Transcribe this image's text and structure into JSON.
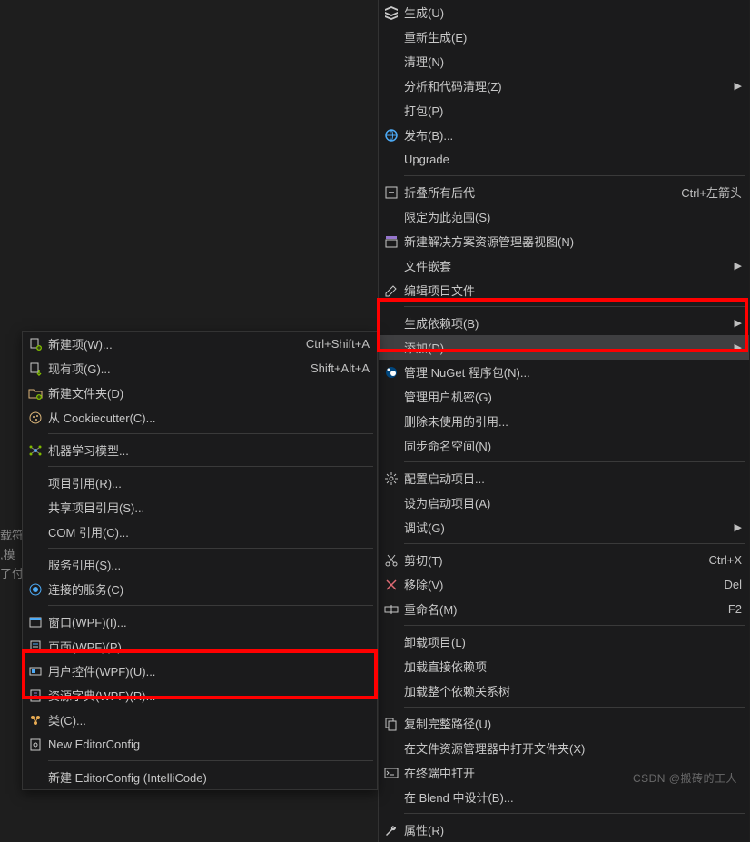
{
  "bg": {
    "line1": "载符",
    "line2": ",模",
    "line3": "了付"
  },
  "main_menu": {
    "items": [
      {
        "icon": "build",
        "label": "生成(U)"
      },
      {
        "icon": "",
        "label": "重新生成(E)"
      },
      {
        "icon": "",
        "label": "清理(N)"
      },
      {
        "icon": "",
        "label": "分析和代码清理(Z)",
        "arrow": true
      },
      {
        "icon": "",
        "label": "打包(P)"
      },
      {
        "icon": "publish",
        "label": "发布(B)..."
      },
      {
        "icon": "",
        "label": "Upgrade"
      },
      {
        "sep": true
      },
      {
        "icon": "collapse",
        "label": "折叠所有后代",
        "shortcut": "Ctrl+左箭头"
      },
      {
        "icon": "",
        "label": "限定为此范围(S)"
      },
      {
        "icon": "view",
        "label": "新建解决方案资源管理器视图(N)"
      },
      {
        "icon": "",
        "label": "文件嵌套",
        "arrow": true
      },
      {
        "icon": "edit",
        "label": "编辑项目文件"
      },
      {
        "sep": true
      },
      {
        "icon": "",
        "label": "生成依赖项(B)",
        "arrow": true
      },
      {
        "icon": "",
        "label": "添加(D)",
        "arrow": true,
        "highlight": true
      },
      {
        "icon": "nuget",
        "label": "管理 NuGet 程序包(N)..."
      },
      {
        "icon": "",
        "label": "管理用户机密(G)"
      },
      {
        "icon": "",
        "label": "删除未使用的引用..."
      },
      {
        "icon": "",
        "label": "同步命名空间(N)"
      },
      {
        "sep": true
      },
      {
        "icon": "gear",
        "label": "配置启动项目..."
      },
      {
        "icon": "",
        "label": "设为启动项目(A)"
      },
      {
        "icon": "",
        "label": "调试(G)",
        "arrow": true
      },
      {
        "sep": true
      },
      {
        "icon": "cut",
        "label": "剪切(T)",
        "shortcut": "Ctrl+X"
      },
      {
        "icon": "remove",
        "label": "移除(V)",
        "shortcut": "Del"
      },
      {
        "icon": "rename",
        "label": "重命名(M)",
        "shortcut": "F2"
      },
      {
        "sep": true
      },
      {
        "icon": "",
        "label": "卸载项目(L)"
      },
      {
        "icon": "",
        "label": "加载直接依赖项"
      },
      {
        "icon": "",
        "label": "加载整个依赖关系树"
      },
      {
        "sep": true
      },
      {
        "icon": "copy",
        "label": "复制完整路径(U)"
      },
      {
        "icon": "",
        "label": "在文件资源管理器中打开文件夹(X)"
      },
      {
        "icon": "terminal",
        "label": "在终端中打开"
      },
      {
        "icon": "",
        "label": "在 Blend 中设计(B)..."
      },
      {
        "sep": true
      },
      {
        "icon": "wrench",
        "label": "属性(R)"
      }
    ]
  },
  "sub_menu": {
    "items": [
      {
        "icon": "newitem",
        "label": "新建项(W)...",
        "shortcut": "Ctrl+Shift+A"
      },
      {
        "icon": "existitem",
        "label": "现有项(G)...",
        "shortcut": "Shift+Alt+A"
      },
      {
        "icon": "newfolder",
        "label": "新建文件夹(D)"
      },
      {
        "icon": "cookie",
        "label": "从 Cookiecutter(C)..."
      },
      {
        "sep": true
      },
      {
        "icon": "ml",
        "label": "机器学习模型..."
      },
      {
        "sep": true
      },
      {
        "icon": "",
        "label": "项目引用(R)..."
      },
      {
        "icon": "",
        "label": "共享项目引用(S)..."
      },
      {
        "icon": "",
        "label": "COM 引用(C)..."
      },
      {
        "sep": true
      },
      {
        "icon": "",
        "label": "服务引用(S)..."
      },
      {
        "icon": "svc",
        "label": "连接的服务(C)"
      },
      {
        "sep": true
      },
      {
        "icon": "window",
        "label": "窗口(WPF)(I)..."
      },
      {
        "icon": "page",
        "label": "页面(WPF)(P)..."
      },
      {
        "icon": "uc",
        "label": "用户控件(WPF)(U)..."
      },
      {
        "icon": "resdict",
        "label": "资源字典(WPF)(R)..."
      },
      {
        "icon": "class",
        "label": "类(C)..."
      },
      {
        "icon": "config",
        "label": "New EditorConfig"
      },
      {
        "sep": true
      },
      {
        "icon": "",
        "label": "新建 EditorConfig (IntelliCode)"
      }
    ]
  },
  "watermark": "CSDN @搬砖的工人"
}
